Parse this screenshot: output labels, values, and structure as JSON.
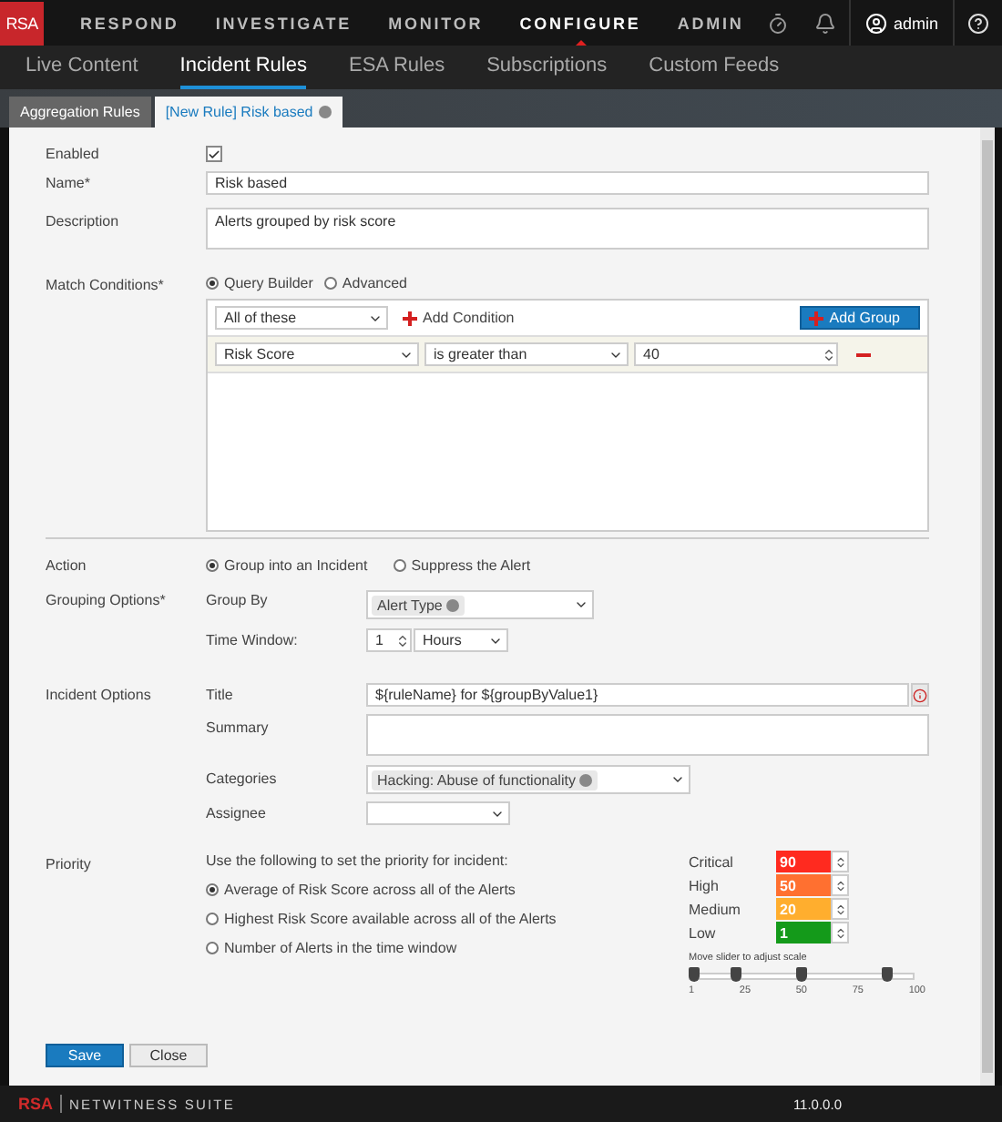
{
  "logo": "RSA",
  "nav": [
    {
      "label": "RESPOND",
      "selected": false
    },
    {
      "label": "INVESTIGATE",
      "selected": false
    },
    {
      "label": "MONITOR",
      "selected": false
    },
    {
      "label": "CONFIGURE",
      "selected": true
    },
    {
      "label": "ADMIN",
      "selected": false
    }
  ],
  "user": {
    "name": "admin"
  },
  "subnav": [
    {
      "label": "Live Content",
      "selected": false
    },
    {
      "label": "Incident Rules",
      "selected": true
    },
    {
      "label": "ESA Rules",
      "selected": false
    },
    {
      "label": "Subscriptions",
      "selected": false
    },
    {
      "label": "Custom Feeds",
      "selected": false
    }
  ],
  "rule_tabs": [
    {
      "label": "Aggregation Rules",
      "selected": false,
      "closable": false
    },
    {
      "label": "[New Rule] Risk based",
      "selected": true,
      "closable": true
    }
  ],
  "form": {
    "enabled": {
      "label": "Enabled",
      "checked": true
    },
    "name": {
      "label": "Name*",
      "value": "Risk based"
    },
    "description": {
      "label": "Description",
      "value": "Alerts grouped by risk score"
    },
    "match": {
      "label": "Match Conditions*",
      "modes": [
        {
          "label": "Query Builder",
          "selected": true
        },
        {
          "label": "Advanced",
          "selected": false
        }
      ],
      "quantifier": "All of these",
      "add_condition": "Add Condition",
      "add_group": "Add Group",
      "conditions": [
        {
          "field": "Risk Score",
          "operator": "is greater than",
          "value": "40"
        }
      ]
    },
    "action": {
      "label": "Action",
      "options": [
        {
          "label": "Group into an Incident",
          "selected": true
        },
        {
          "label": "Suppress the Alert",
          "selected": false
        }
      ]
    },
    "grouping": {
      "label": "Grouping Options*",
      "group_by_label": "Group By",
      "group_by": [
        "Alert Type"
      ],
      "time_window_label": "Time Window:",
      "time_value": "1",
      "time_unit": "Hours"
    },
    "incident": {
      "label": "Incident Options",
      "title_label": "Title",
      "title": "${ruleName} for ${groupByValue1}",
      "summary_label": "Summary",
      "categories_label": "Categories",
      "categories": [
        "Hacking: Abuse of functionality"
      ],
      "assignee_label": "Assignee"
    },
    "priority": {
      "label": "Priority",
      "intro": "Use the following to set the priority for incident:",
      "options": [
        {
          "label": "Average of Risk Score across all of the Alerts",
          "selected": true
        },
        {
          "label": "Highest Risk Score available across all of the Alerts",
          "selected": false
        },
        {
          "label": "Number of Alerts in the time window",
          "selected": false
        }
      ],
      "levels": [
        {
          "name": "Critical",
          "value": "90",
          "color": "#ff2a1f"
        },
        {
          "name": "High",
          "value": "50",
          "color": "#ff7030"
        },
        {
          "name": "Medium",
          "value": "20",
          "color": "#ffae2e"
        },
        {
          "name": "Low",
          "value": "1",
          "color": "#149a1a"
        }
      ],
      "slider_caption": "Move slider to adjust scale",
      "thumbs": [
        {
          "level": 0
        },
        {
          "level": 0.19
        },
        {
          "level": 0.48
        },
        {
          "level": 0.87
        }
      ],
      "scale": [
        "1",
        "25",
        "50",
        "75",
        "100"
      ]
    }
  },
  "buttons": {
    "save": "Save",
    "close": "Close"
  },
  "footer": {
    "brand": "RSA",
    "product": "NETWITNESS SUITE",
    "version": "11.0.0.0"
  }
}
